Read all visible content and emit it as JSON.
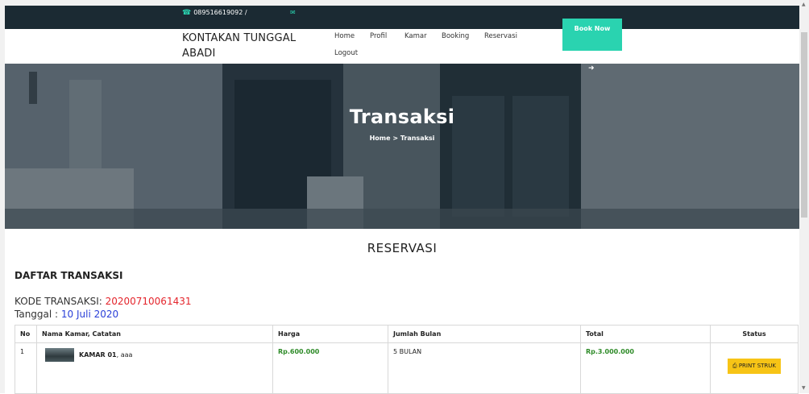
{
  "topbar": {
    "phone": "089516619092 /"
  },
  "brand": {
    "line1": "KONTAKAN TUNGGAL",
    "line2": "ABADI"
  },
  "nav": {
    "home": "Home",
    "profil": "Profil",
    "kamar": "Kamar",
    "booking": "Booking",
    "reservasi": "Reservasi",
    "logout": "Logout"
  },
  "book_now": "Book Now",
  "hero": {
    "title": "Transaksi",
    "crumb_home": "Home",
    "crumb_sep": ">",
    "crumb_current": "Transaksi"
  },
  "section": {
    "title": "RESERVASI",
    "list_title": "DAFTAR TRANSAKSI"
  },
  "kode": {
    "label": "KODE TRANSAKSI: ",
    "value": "20200710061431"
  },
  "tanggal": {
    "label": "Tanggal : ",
    "value": "10 Juli 2020"
  },
  "table": {
    "headers": {
      "no": "No",
      "nama": "Nama Kamar, Catatan",
      "harga": "Harga",
      "jumlah": "Jumlah Bulan",
      "total": "Total",
      "status": "Status"
    },
    "rows": [
      {
        "no": "1",
        "kamar": "KAMAR 01",
        "catatan": ", aaa",
        "harga": "Rp.600.000",
        "jumlah": "5 BULAN",
        "total": "Rp.3.000.000",
        "action": "PRINT STRUK"
      }
    ]
  },
  "colors": {
    "topbar": "#1b2a33",
    "accent": "#2ad3b0",
    "kode_value": "#e4252c",
    "tanggal_value": "#2a3fd8",
    "price": "#2e8b28",
    "print_button": "#f7c416"
  },
  "icons": {
    "phone": "phone-icon",
    "mail": "envelope-icon",
    "print": "print-icon",
    "arrow": "arrow-right-icon"
  }
}
